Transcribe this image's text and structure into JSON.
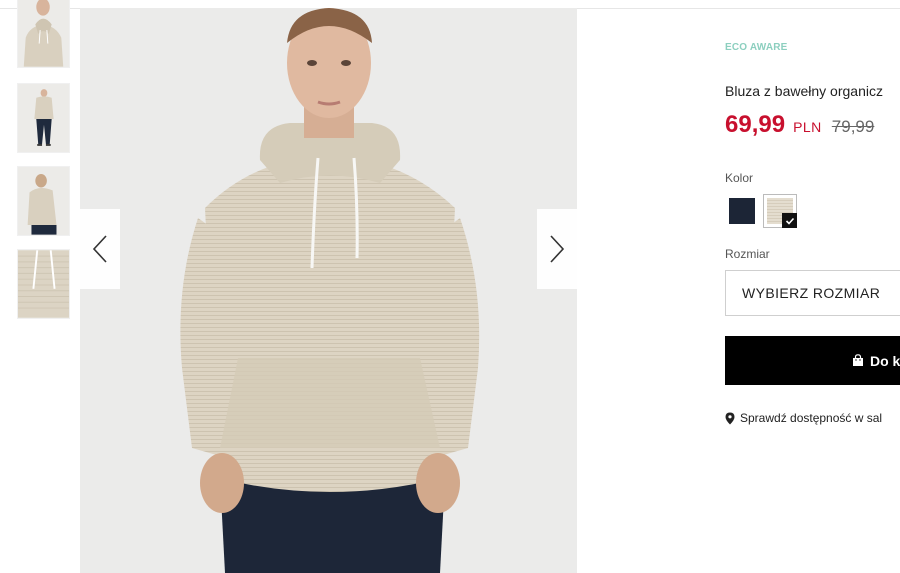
{
  "product": {
    "eco_tag": "ECO AWARE",
    "title": "Bluza z bawełny organicz",
    "price": "69,99",
    "currency": "PLN",
    "old_price": "79,99"
  },
  "color": {
    "label": "Kolor",
    "options": [
      {
        "name": "navy",
        "hex": "#1c2536",
        "selected": false
      },
      {
        "name": "beige",
        "hex": "#e4ddcf",
        "selected": true
      }
    ]
  },
  "size": {
    "label": "Rozmiar",
    "select_text": "WYBIERZ ROZMIAR"
  },
  "cart": {
    "button_label": "Do k",
    "icon": "shopping-bag-icon"
  },
  "store": {
    "link_text": "Sprawdź dostępność w sal",
    "icon": "map-pin-icon"
  },
  "gallery": {
    "prev_icon": "chevron-left-icon",
    "next_icon": "chevron-right-icon",
    "thumbnail_count": 4
  },
  "colors": {
    "price_red": "#c8102e",
    "eco_green": "#8ccfbf",
    "button_black": "#000000"
  }
}
